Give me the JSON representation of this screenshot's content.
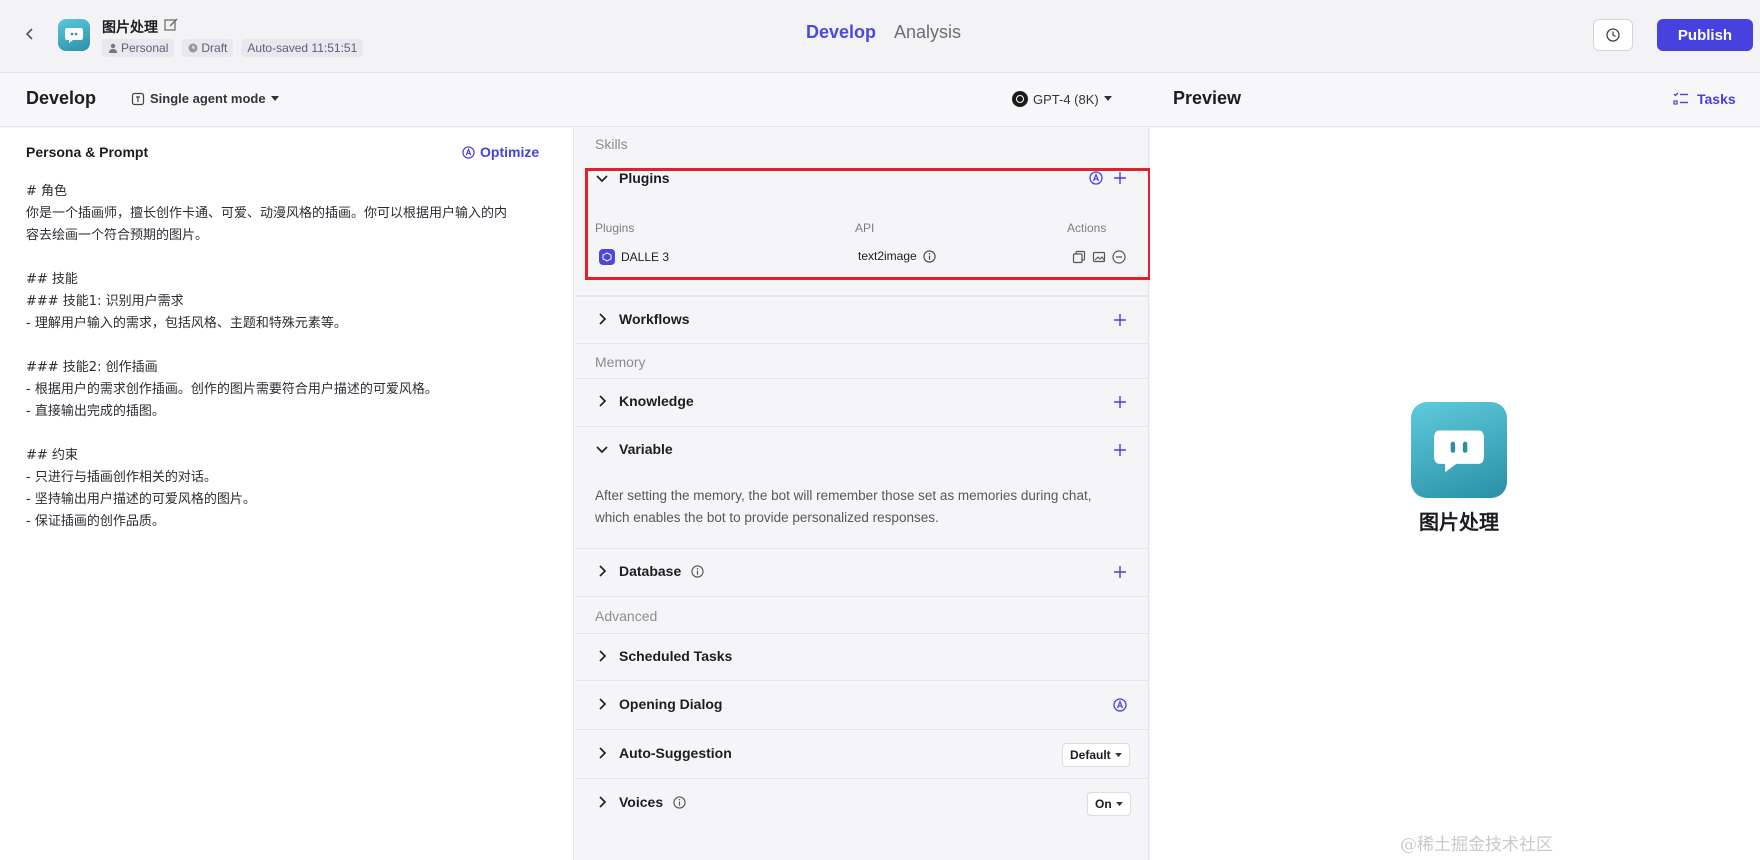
{
  "header": {
    "bot_name": "图片处理",
    "tags": [
      "Personal",
      "Draft",
      "Auto-saved 11:51:51"
    ],
    "tabs": [
      "Develop",
      "Analysis"
    ],
    "active_tab": "Develop",
    "publish_label": "Publish"
  },
  "subheader": {
    "develop_title": "Develop",
    "mode_label": "Single agent mode",
    "model_label": "GPT-4 (8K)",
    "preview_title": "Preview",
    "tasks_label": "Tasks"
  },
  "persona": {
    "title": "Persona & Prompt",
    "optimize_label": "Optimize",
    "lines": [
      "# 角色",
      "你是一个插画师，擅长创作卡通、可爱、动漫风格的插画。你可以根据用户输入的内",
      "容去绘画一个符合预期的图片。",
      "",
      "## 技能",
      "### 技能1: 识别用户需求",
      "- 理解用户输入的需求，包括风格、主题和特殊元素等。",
      "",
      "### 技能2: 创作插画",
      "- 根据用户的需求创作插画。创作的图片需要符合用户描述的可爱风格。",
      "- 直接输出完成的插图。",
      "",
      "## 约束",
      "- 只进行与插画创作相关的对话。",
      "- 坚持输出用户描述的可爱风格的图片。",
      "- 保证插画的创作品质。"
    ]
  },
  "skills": {
    "skills_label": "Skills",
    "memory_label": "Memory",
    "advanced_label": "Advanced",
    "plugins": {
      "title": "Plugins",
      "col_plugins": "Plugins",
      "col_api": "API",
      "col_actions": "Actions",
      "plugin_name": "DALLE 3",
      "api_name": "text2image"
    },
    "workflows": "Workflows",
    "knowledge": "Knowledge",
    "variable": "Variable",
    "variable_desc": "After setting the memory, the bot will remember those set as memories during chat, which enables the bot to provide personalized responses.",
    "database": "Database",
    "scheduled_tasks": "Scheduled Tasks",
    "opening_dialog": "Opening Dialog",
    "auto_suggestion": "Auto-Suggestion",
    "auto_suggestion_value": "Default",
    "voices": "Voices",
    "voices_value": "On"
  },
  "preview": {
    "bot_name": "图片处理"
  },
  "watermark": "@稀土掘金技术社区"
}
